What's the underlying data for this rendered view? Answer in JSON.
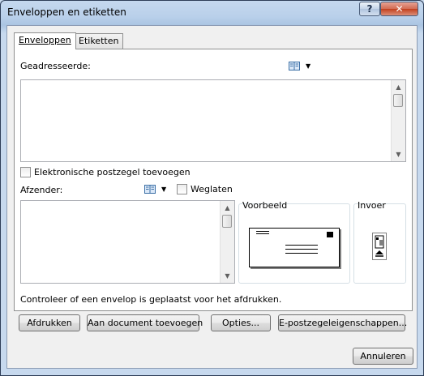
{
  "window": {
    "title": "Enveloppen en etiketten",
    "help_label": "?",
    "close_label": "✕"
  },
  "tabs": [
    {
      "label": "Enveloppen"
    },
    {
      "label": "Etiketten"
    }
  ],
  "recipient": {
    "label": "Geadresseerde:",
    "value": ""
  },
  "e_postage": {
    "label": "Elektronische postzegel toevoegen",
    "checked": false
  },
  "sender": {
    "label": "Afzender:",
    "value": "",
    "omit_label": "Weglaten",
    "omit_checked": false
  },
  "preview": {
    "label": "Voorbeeld"
  },
  "feed": {
    "label": "Invoer"
  },
  "status_text": "Controleer of een envelop is geplaatst voor het afdrukken.",
  "buttons": {
    "print": "Afdrukken",
    "add_to_document": "Aan document toevoegen",
    "options": "Opties...",
    "e_postage_properties": "E-postzegeleigenschappen...",
    "cancel": "Annuleren"
  },
  "colors": {
    "title_bar": "#b9d0ea",
    "dialog_bg": "#f0f0f0",
    "close_button": "#c2401e"
  },
  "icons": {
    "address_book": "address-book-icon",
    "dropdown": "chevron-down-icon"
  }
}
